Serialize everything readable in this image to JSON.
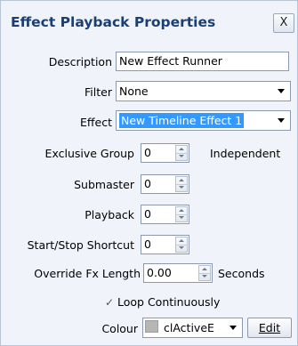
{
  "window": {
    "title": "Effect Playback Properties",
    "close_label": "X"
  },
  "form": {
    "description": {
      "label": "Description",
      "value": "New Effect Runner"
    },
    "filter": {
      "label": "Filter",
      "value": "None"
    },
    "effect": {
      "label": "Effect",
      "value": "New Timeline Effect 1"
    },
    "exclusive_group": {
      "label": "Exclusive Group",
      "value": "0",
      "suffix": "Independent"
    },
    "submaster": {
      "label": "Submaster",
      "value": "0"
    },
    "playback": {
      "label": "Playback",
      "value": "0"
    },
    "start_stop_shortcut": {
      "label": "Start/Stop Shortcut",
      "value": "0"
    },
    "override_fx_length": {
      "label": "Override Fx Length",
      "value": "0.00",
      "suffix": "Seconds"
    },
    "loop_continuously": {
      "label": "Loop Continuously",
      "checked": true,
      "mark": "✓"
    },
    "colour": {
      "label": "Colour",
      "value": "clActiveE",
      "swatch": "#b6b6b6",
      "edit_label": "Edit"
    }
  }
}
